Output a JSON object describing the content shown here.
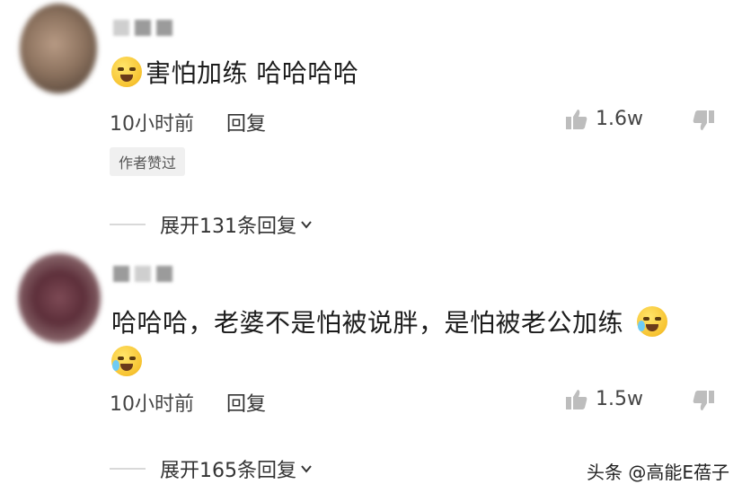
{
  "comments": [
    {
      "content": "害怕加练  哈哈哈哈",
      "time": "10小时前",
      "reply_label": "回复",
      "likes": "1.6w",
      "badge": "作者赞过",
      "expand": "展开131条回复"
    },
    {
      "content_line1": "哈哈哈，老婆不是怕被说胖，是怕被老公加练",
      "time": "10小时前",
      "reply_label": "回复",
      "likes": "1.5w",
      "expand": "展开165条回复"
    }
  ],
  "watermark": "头条 @高能E蓓子",
  "icons": {
    "like": "thumbs-up-icon",
    "dislike": "thumbs-down-icon",
    "emoji_scared": "scared-face-emoji",
    "emoji_laugh": "laughing-tears-emoji"
  }
}
